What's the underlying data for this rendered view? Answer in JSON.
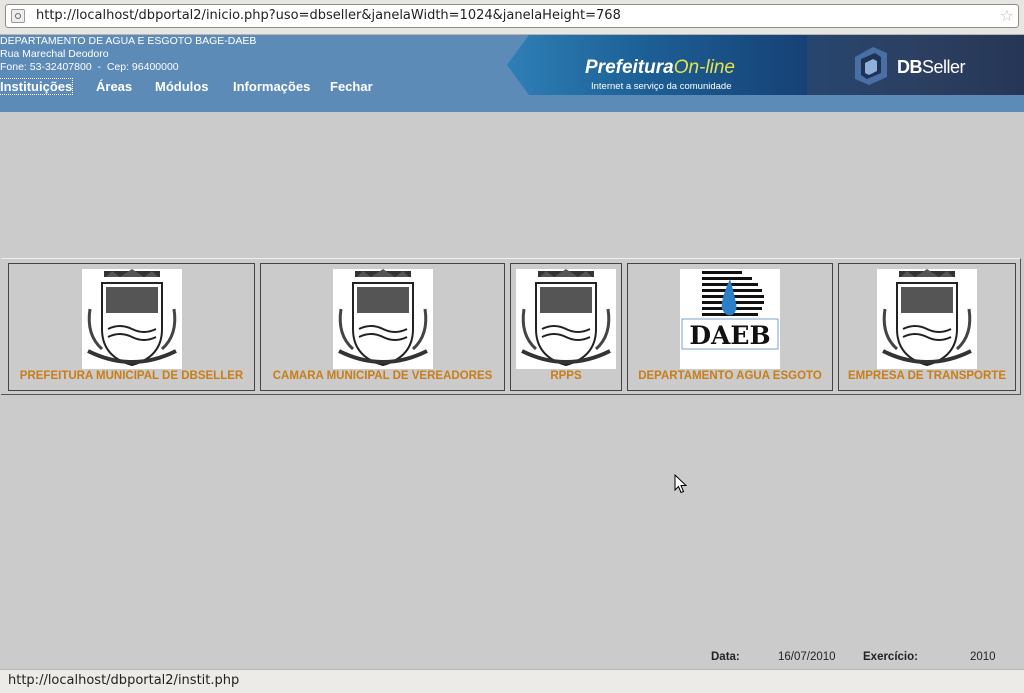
{
  "browser": {
    "url": "http://localhost/dbportal2/inicio.php?uso=dbseller&janelaWidth=1024&janelaHeight=768",
    "status_url": "http://localhost/dbportal2/instit.php"
  },
  "header": {
    "org_name": "DEPARTAMENTO DE AGUA E ESGOTO BAGE-DAEB",
    "address": "Rua Marechal Deodoro",
    "phone_cep": "Fone: 53-32407800  -  Cep: 96400000",
    "menu": [
      "Instituições",
      "Áreas",
      "Módulos",
      "Informações",
      "Fechar"
    ]
  },
  "banner": {
    "prefeitura": "Prefeitura",
    "online": "On-line",
    "slogan": "Internet a serviço da comunidade",
    "db": "DB",
    "seller": "Seller"
  },
  "institutions": [
    {
      "name": "PREFEITURA MUNICIPAL DE DBSELLER",
      "logo": "coat-of-arms"
    },
    {
      "name": "CAMARA MUNICIPAL DE VEREADORES",
      "logo": "coat-of-arms"
    },
    {
      "name": "RPPS",
      "logo": "coat-of-arms"
    },
    {
      "name": "DEPARTAMENTO AGUA ESGOTO",
      "logo": "daeb-logo",
      "logo_text": "DAEB"
    },
    {
      "name": "EMPRESA DE TRANSPORTE",
      "logo": "coat-of-arms"
    }
  ],
  "footer": {
    "date_label": "Data:",
    "date_value": "16/07/2010",
    "year_label": "Exercício:",
    "year_value": "2010"
  },
  "colors": {
    "header_bg": "#5d8bb8",
    "institution_label": "#c97d17",
    "page_bg": "#cbcbcb"
  }
}
